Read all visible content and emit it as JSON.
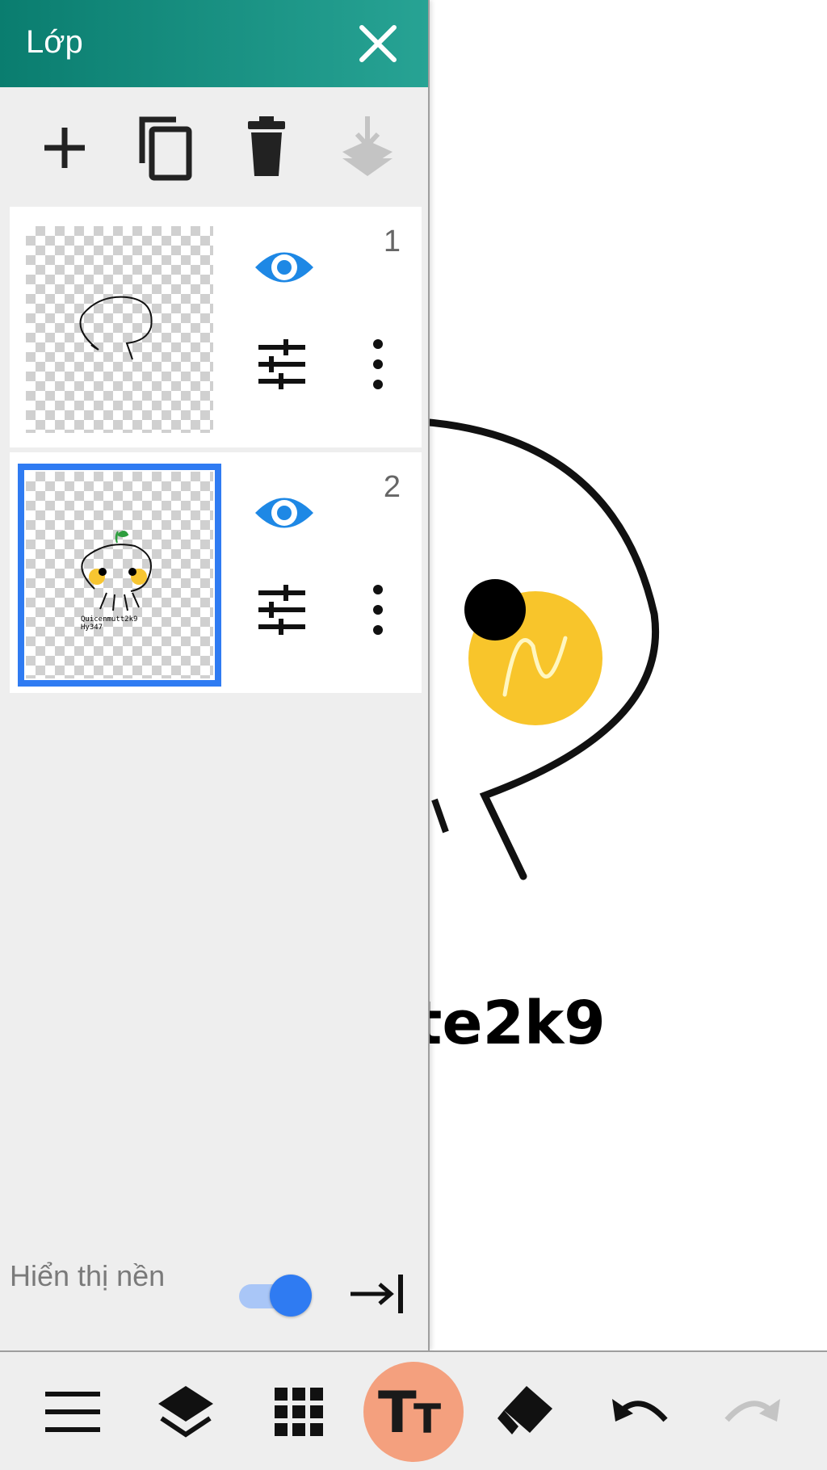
{
  "panel": {
    "title": "Lớp",
    "header_colors": [
      "#0a7d6f",
      "#27a394"
    ],
    "toolbar": [
      "add-layer-icon",
      "duplicate-layer-icon",
      "delete-layer-icon",
      "merge-down-icon"
    ]
  },
  "layers": [
    {
      "number": "1",
      "visible": true,
      "selected": false
    },
    {
      "number": "2",
      "visible": true,
      "selected": true,
      "thumb_text_line1": "Quicenmutt2k9",
      "thumb_text_line2": "Hy347"
    }
  ],
  "background": {
    "label": "Hiển thị nền",
    "enabled": true
  },
  "canvas": {
    "visible_text": "te2k9"
  },
  "bottom_toolbar": [
    "menu-icon",
    "layers-icon",
    "grid-icon",
    "text-tool-icon",
    "eraser-icon",
    "undo-icon",
    "redo-icon"
  ],
  "accent_colors": {
    "selection": "#2f7bf2",
    "eye": "#1e88e5",
    "text_tool": "#f4a07e"
  }
}
